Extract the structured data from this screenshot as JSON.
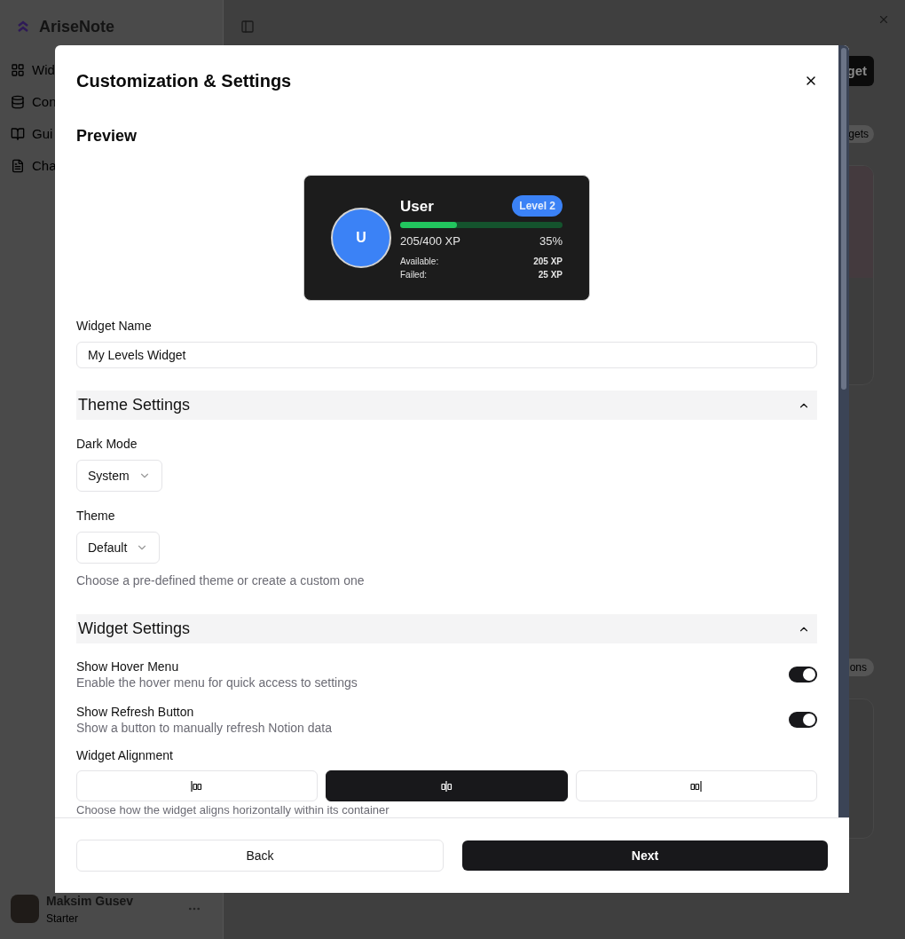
{
  "sidebar": {
    "brand": "AriseNote",
    "items": [
      {
        "label": "Wid",
        "kind": "widgets"
      },
      {
        "label": "Con",
        "kind": "database"
      },
      {
        "label": "Gui",
        "kind": "book"
      },
      {
        "label": "Cha",
        "kind": "file"
      }
    ],
    "user": {
      "name": "Maksim Gusev",
      "plan": "Starter"
    }
  },
  "main": {
    "button": "get",
    "chips": [
      "gets",
      "ons"
    ]
  },
  "modal": {
    "title": "Customization & Settings",
    "preview": {
      "heading": "Preview",
      "widget": {
        "avatar": "U",
        "name": "User",
        "badge": "Level 2",
        "level": 0.35,
        "xp": "205/400 XP",
        "percent": "35%",
        "stats": [
          {
            "label": "Available:",
            "value": "205 XP"
          },
          {
            "label": "Failed:",
            "value": "25 XP"
          }
        ]
      }
    },
    "widget_name": {
      "label": "Widget Name",
      "value": "My Levels Widget"
    },
    "theme_section": {
      "title": "Theme Settings",
      "expanded": true,
      "selects": [
        {
          "label": "Dark Mode",
          "value": "System"
        },
        {
          "label": "Theme",
          "value": "Default"
        }
      ],
      "hint": "Choose a pre-defined theme or create a custom one"
    },
    "widget_section": {
      "title": "Widget Settings",
      "expanded": true,
      "toggles": [
        {
          "label": "Show Hover Menu",
          "description": "Enable the hover menu for quick access to settings",
          "on": true
        },
        {
          "label": "Show Refresh Button",
          "description": "Show a button to manually refresh Notion data",
          "on": true
        }
      ],
      "alignment": {
        "label": "Widget Alignment",
        "options": [
          {
            "kind": "left",
            "selected": false
          },
          {
            "kind": "center",
            "selected": true
          },
          {
            "kind": "right",
            "selected": false
          }
        ],
        "hint": "Choose how the widget aligns horizontally within its container"
      }
    },
    "buttons": {
      "back": "Back",
      "next": "Next"
    }
  }
}
